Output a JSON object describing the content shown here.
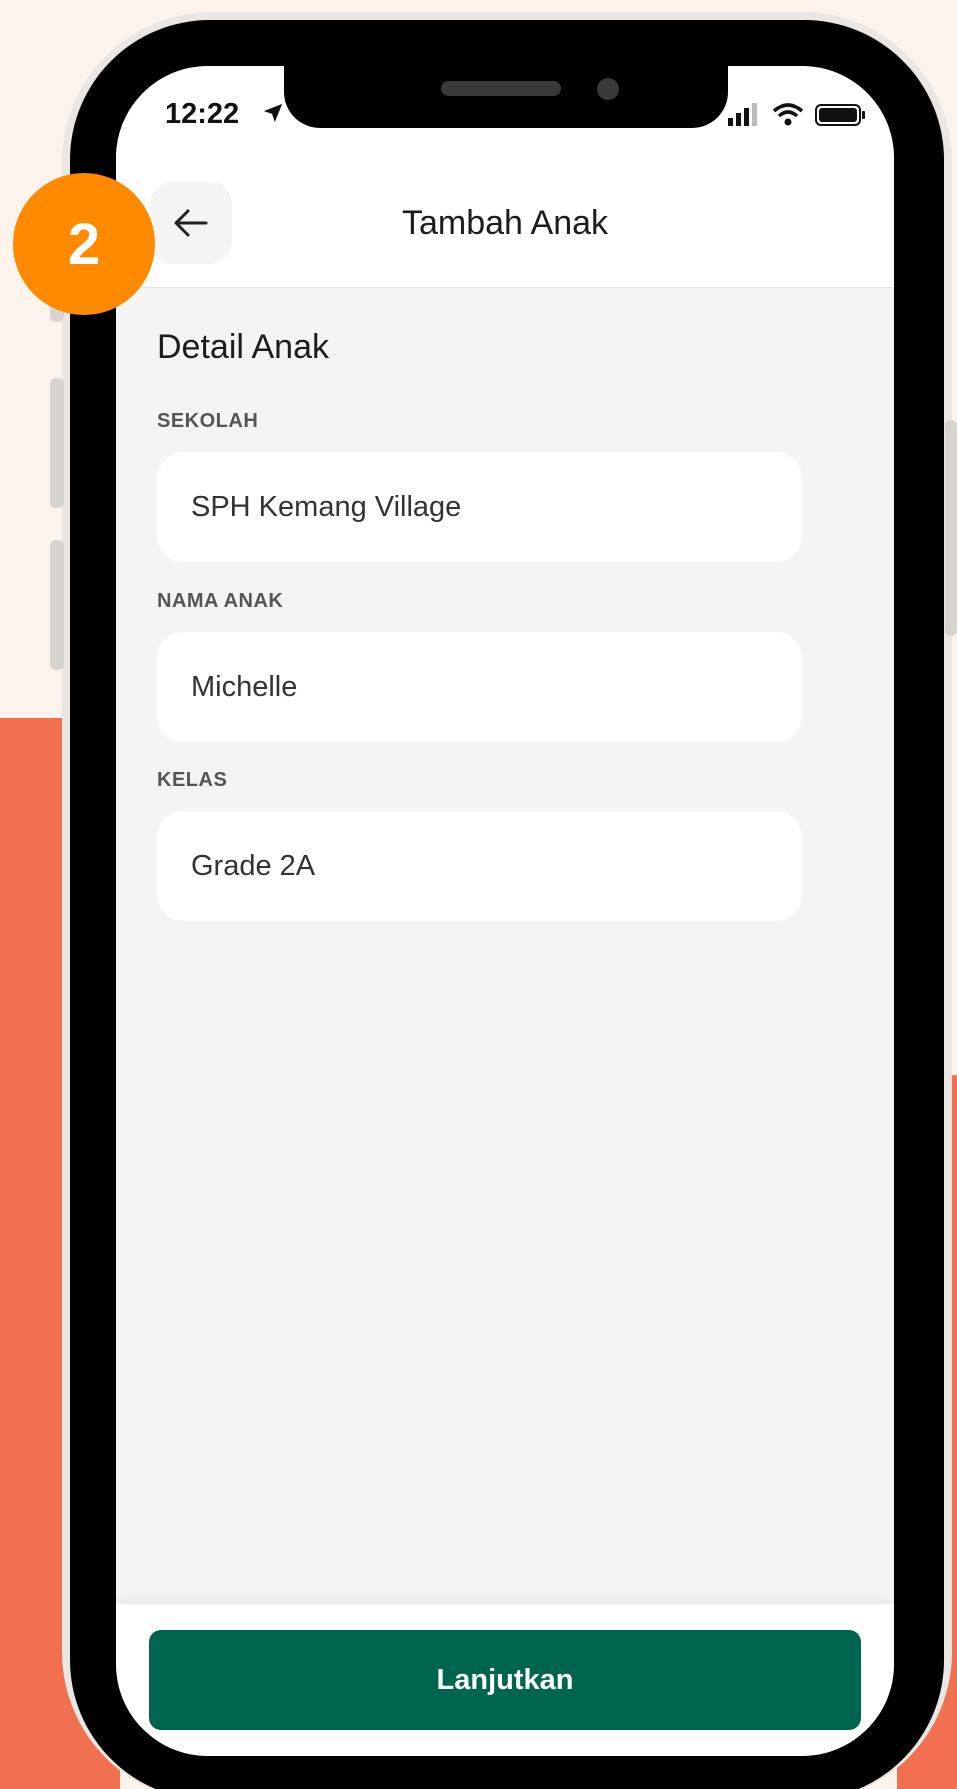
{
  "status_bar": {
    "time": "12:22"
  },
  "header": {
    "title": "Tambah Anak",
    "back_icon": "arrow-left-icon"
  },
  "step_badge": {
    "number": "2"
  },
  "form": {
    "section_title": "Detail Anak",
    "fields": [
      {
        "label": "SEKOLAH",
        "value": "SPH Kemang Village"
      },
      {
        "label": "NAMA ANAK",
        "value": "Michelle"
      },
      {
        "label": "KELAS",
        "value": "Grade 2A"
      }
    ]
  },
  "footer": {
    "button_label": "Lanjutkan"
  },
  "colors": {
    "background": "#fbf3ec",
    "accent_coral": "#f07050",
    "badge_orange": "#ff8a00",
    "primary_button": "#00654f",
    "screen_bg": "#f4f4f4"
  }
}
